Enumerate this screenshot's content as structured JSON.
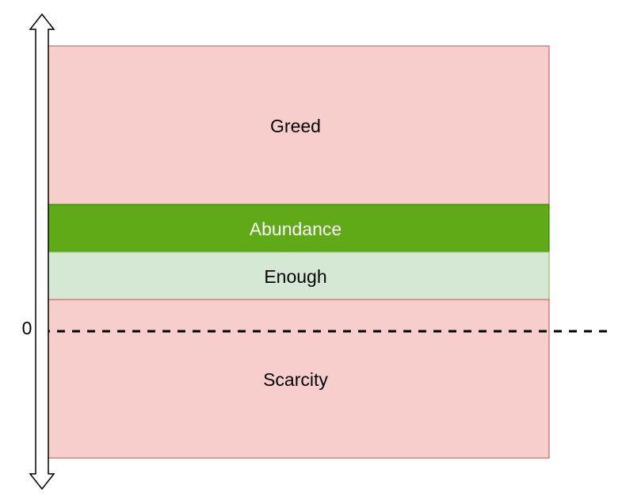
{
  "diagram": {
    "bands": [
      {
        "id": "greed",
        "label": "Greed",
        "fill": "#f8cecc",
        "stroke": "#b85450",
        "text_color": "#000000"
      },
      {
        "id": "abundance",
        "label": "Abundance",
        "fill": "#60a917",
        "stroke": "#2d7600",
        "text_color": "#ffffff"
      },
      {
        "id": "enough",
        "label": "Enough",
        "fill": "#d5e8d4",
        "stroke": "#82b366",
        "text_color": "#000000"
      },
      {
        "id": "scarcity",
        "label": "Scarcity",
        "fill": "#f8cecc",
        "stroke": "#b85450",
        "text_color": "#000000"
      }
    ],
    "zero_label": "0",
    "axis": {
      "direction": "bidirectional-vertical",
      "icon": "double-arrow-icon"
    },
    "zero_line": {
      "style": "dashed",
      "color": "#000000"
    }
  }
}
